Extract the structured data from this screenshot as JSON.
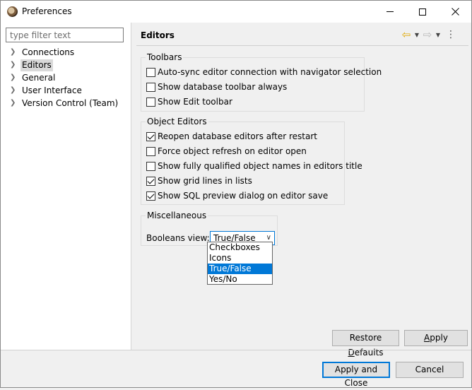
{
  "window": {
    "title": "Preferences",
    "minimize_icon": "minimize-icon",
    "maximize_icon": "maximize-icon",
    "close_icon": "close-icon"
  },
  "filter": {
    "placeholder": "type filter text",
    "value": ""
  },
  "tree": {
    "items": [
      {
        "label": "Connections",
        "selected": false
      },
      {
        "label": "Editors",
        "selected": true
      },
      {
        "label": "General",
        "selected": false
      },
      {
        "label": "User Interface",
        "selected": false
      },
      {
        "label": "Version Control (Team)",
        "selected": false
      }
    ]
  },
  "page": {
    "title": "Editors",
    "nav": {
      "back_icon": "back-arrow-icon",
      "forward_icon": "forward-arrow-icon",
      "menu_icon": "view-menu-icon"
    }
  },
  "groups": {
    "toolbars": {
      "title": "Toolbars",
      "options": [
        {
          "label": "Auto-sync editor connection with navigator selection",
          "checked": false
        },
        {
          "label": "Show database toolbar always",
          "checked": false
        },
        {
          "label": "Show Edit toolbar",
          "checked": false
        }
      ]
    },
    "object_editors": {
      "title": "Object Editors",
      "options": [
        {
          "label": "Reopen database editors after restart",
          "checked": true
        },
        {
          "label": "Force object refresh on editor open",
          "checked": false
        },
        {
          "label": "Show fully qualified object names in editors title",
          "checked": false
        },
        {
          "label": "Show grid lines in lists",
          "checked": true
        },
        {
          "label": "Show SQL preview dialog on editor save",
          "checked": true
        }
      ]
    },
    "misc": {
      "title": "Miscellaneous",
      "booleans_label": "Booleans view:",
      "booleans_value": "True/False",
      "booleans_options": [
        "Checkboxes",
        "Icons",
        "True/False",
        "Yes/No"
      ],
      "booleans_selected_index": 2
    }
  },
  "buttons": {
    "restore_defaults_pre": "Restore ",
    "restore_defaults_u": "D",
    "restore_defaults_post": "efaults",
    "apply_u": "A",
    "apply_post": "pply",
    "apply_and_close": "Apply and Close",
    "cancel": "Cancel"
  }
}
